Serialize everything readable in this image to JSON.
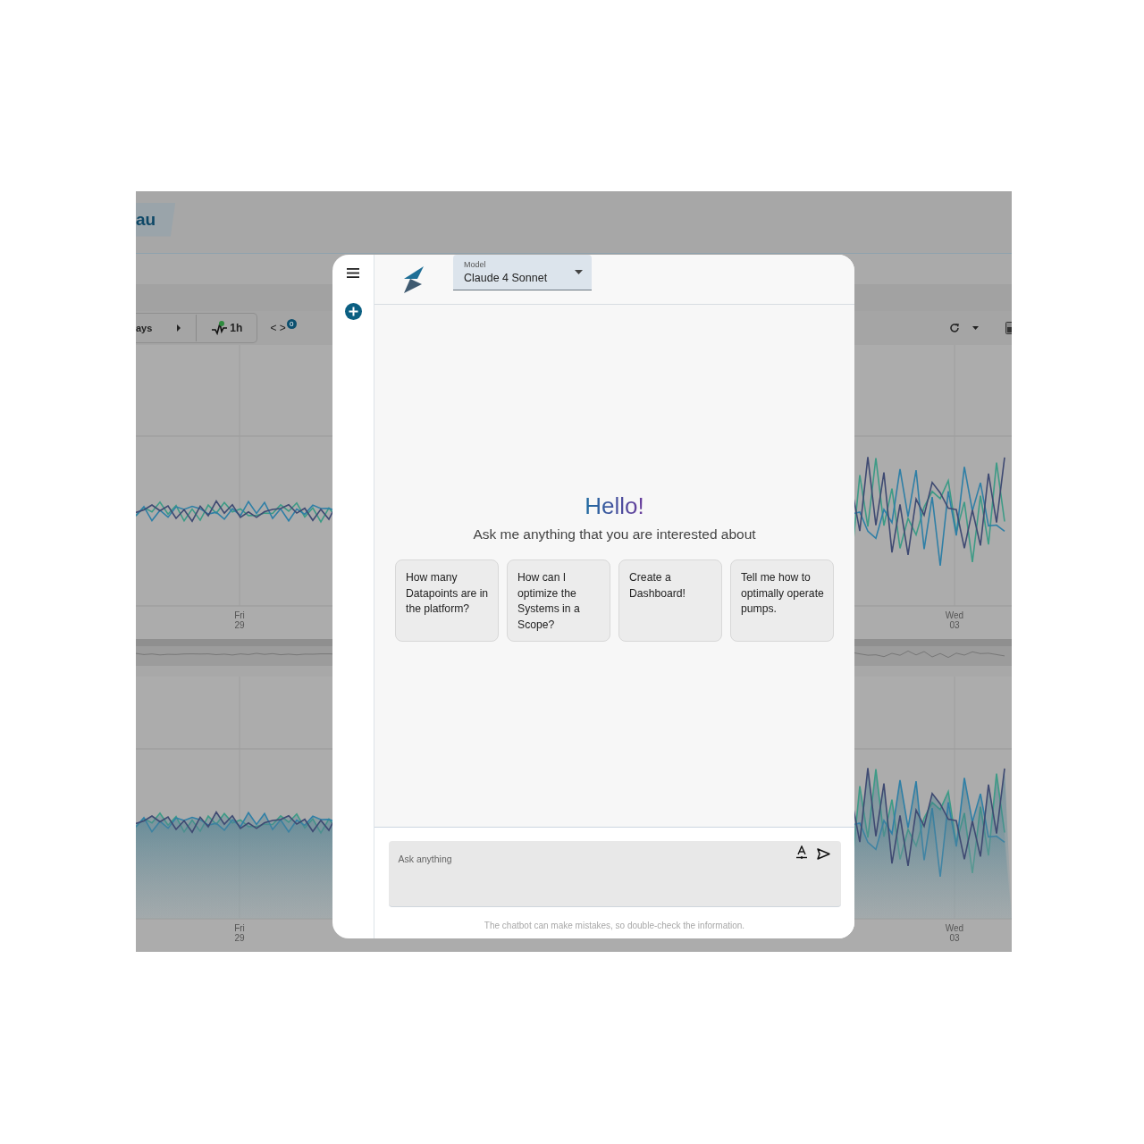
{
  "background_app": {
    "title_tab": "au",
    "toolbar": {
      "range_label": "ays",
      "interval_label": "1h",
      "code_toggle": "< >",
      "code_badge": "0"
    },
    "charts": [
      {
        "kind": "line",
        "x_labels": [
          {
            "day": "Fri",
            "date": "29"
          },
          {
            "day": "Wed",
            "date": "03"
          }
        ]
      },
      {
        "kind": "area",
        "x_labels": [
          {
            "day": "Fri",
            "date": "29"
          },
          {
            "day": "Wed",
            "date": "03"
          }
        ]
      }
    ]
  },
  "chat": {
    "model_select": {
      "label": "Model",
      "value": "Claude 4 Sonnet"
    },
    "greeting": "Hello!",
    "subtitle": "Ask me anything that you are interested about",
    "suggestions": [
      "How many Datapoints are in the platform?",
      "How can I optimize the Systems in a Scope?",
      "Create a Dashboard!",
      "Tell me how to optimally operate pumps."
    ],
    "input": {
      "placeholder": "Ask anything"
    },
    "disclaimer": "The chatbot can make mistakes, so double-check the information."
  }
}
